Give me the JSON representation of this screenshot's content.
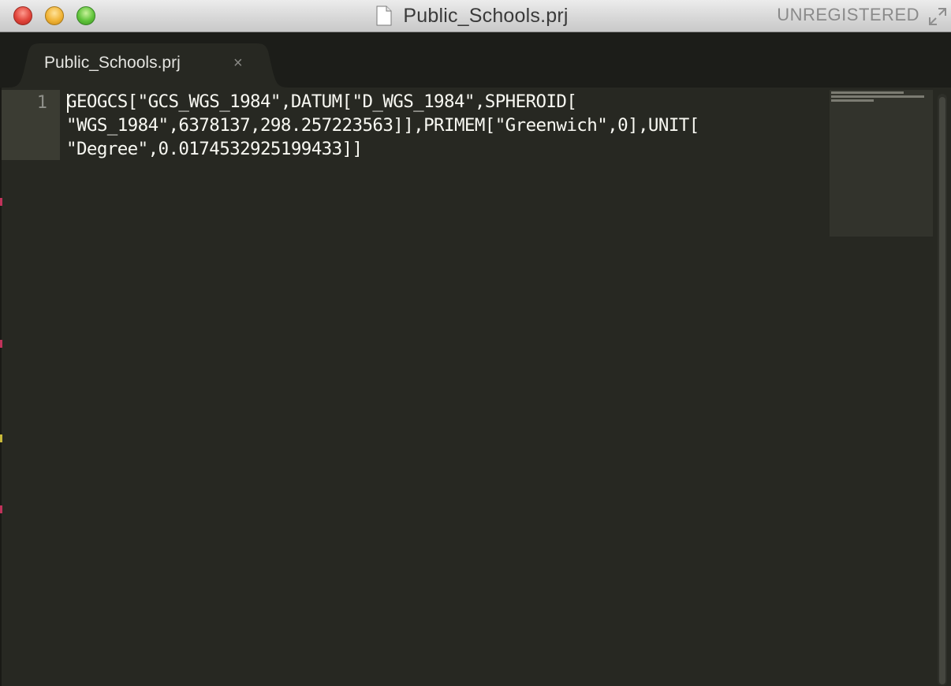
{
  "window": {
    "title": "Public_Schools.prj",
    "registration_status": "UNREGISTERED"
  },
  "tabs": [
    {
      "label": "Public_Schools.prj",
      "close_glyph": "×",
      "active": true
    }
  ],
  "editor": {
    "line_numbers": [
      "1"
    ],
    "wrapped_lines": [
      "GEOGCS[\"GCS_WGS_1984\",DATUM[\"D_WGS_1984\",SPHEROID[",
      "\"WGS_1984\",6378137,298.257223563]],PRIMEM[\"Greenwich\",0],UNIT[",
      "\"Degree\",0.0174532925199433]]"
    ],
    "theme_colors": {
      "background": "#272822",
      "text": "#f8f8f2",
      "gutter_text": "#8f908a",
      "active_line": "#3b3c33"
    }
  },
  "icons": {
    "traffic_lights": [
      "close-button",
      "minimize-button",
      "zoom-button"
    ],
    "title_icon": "document-icon",
    "fullscreen": "fullscreen-icon"
  }
}
